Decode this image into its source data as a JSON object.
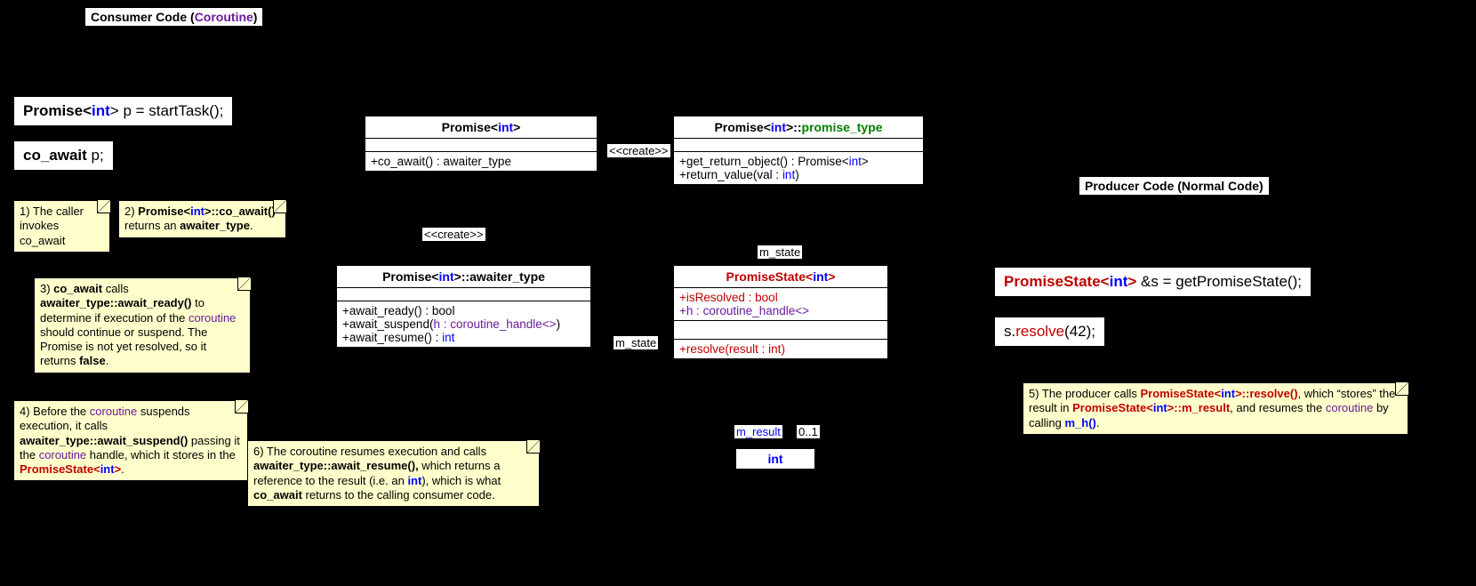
{
  "headers": {
    "consumer_pre": "Consumer Code (",
    "consumer_coroutine": "Coroutine",
    "consumer_post": ")",
    "producer": "Producer Code (Normal Code)"
  },
  "code": {
    "line1_a": "Promise<",
    "line1_int": "int",
    "line1_b": "> p = startTask();",
    "line2_a": "co_await",
    "line2_b": " p;",
    "prod1_a": "PromiseState<",
    "prod1_int": "int",
    "prod1_b": "> ",
    "prod1_c": "&s = getPromiseState();",
    "prod2_a": "s.",
    "prod2_resolve": "resolve",
    "prod2_b": "(42);"
  },
  "relations": {
    "create1": "<<create>>",
    "create2": "<<create>>",
    "mstate1": "m_state",
    "mstate2": "m_state",
    "mresult": "m_result",
    "mult": "0..1",
    "int_box": "int"
  },
  "uml": {
    "promise": {
      "title_a": "Promise<",
      "title_int": "int",
      "title_b": ">",
      "op": "+co_await() : awaiter_type"
    },
    "promise_type": {
      "title_a": "Promise<",
      "title_int": "int",
      "title_b": ">::",
      "title_pt": "promise_type",
      "op1_a": "+get_return_object() : Promise<",
      "op1_int": "int",
      "op1_b": ">",
      "op2_a": "+return_value(val : ",
      "op2_int": "int",
      "op2_b": ")"
    },
    "awaiter": {
      "title_a": "Promise<",
      "title_int": "int",
      "title_b": ">::awaiter_type",
      "op1": "+await_ready() : bool",
      "op2_a": "+await_suspend(",
      "op2_h": "h : coroutine_handle<>",
      "op2_b": ")",
      "op3_a": "+await_resume() : ",
      "op3_int": "int"
    },
    "state": {
      "title_a": "PromiseState<",
      "title_int": "int",
      "title_b": ">",
      "attr1": "+isResolved : bool",
      "attr2": "+h : coroutine_handle<>",
      "op_a": "+resolve(",
      "op_res": "result : int",
      "op_b": ")"
    }
  },
  "notes": {
    "n1": "1) The caller invokes co_await",
    "n2_a": "2) ",
    "n2_b": "Promise<",
    "n2_int": "int",
    "n2_c": ">::co_await()",
    "n2_d": " returns an ",
    "n2_e": "awaiter_type",
    "n2_f": ".",
    "n3_a": "3) ",
    "n3_b": "co_await",
    "n3_c": " calls ",
    "n3_d": "awaiter_type::await_ready()",
    "n3_e": " to determine if execution of the ",
    "n3_f": "coroutine",
    "n3_g": " should continue or suspend.  The Promise is not yet resolved, so it returns ",
    "n3_h": "false",
    "n3_i": ".",
    "n4_a": "4) Before the ",
    "n4_b": "coroutine",
    "n4_c": " suspends execution, it calls ",
    "n4_d": "awaiter_type::await_suspend()",
    "n4_e": " passing it the ",
    "n4_f": "coroutine",
    "n4_g": " handle, which it stores in the ",
    "n4_h": "PromiseState<",
    "n4_int": "int",
    "n4_i": ">",
    "n4_j": ".",
    "n5_a": "5) The producer calls ",
    "n5_b": "PromiseState<",
    "n5_int1": "int",
    "n5_c": ">::resolve()",
    "n5_d": ", which “stores” the result in ",
    "n5_e": "PromiseState<",
    "n5_int2": "int",
    "n5_f": ">::m_result",
    "n5_g": ", and resumes the ",
    "n5_h": "coroutine",
    "n5_i": " by calling ",
    "n5_j": "m_h()",
    "n5_k": ".",
    "n6_a": "6) The coroutine resumes execution and calls ",
    "n6_b": "awaiter_type::await_resume(),",
    "n6_c": " which returns a reference to the result (i.e. an ",
    "n6_d": "int",
    "n6_e": "), which is what ",
    "n6_f": "co_await",
    "n6_g": " returns to the calling consumer code."
  }
}
